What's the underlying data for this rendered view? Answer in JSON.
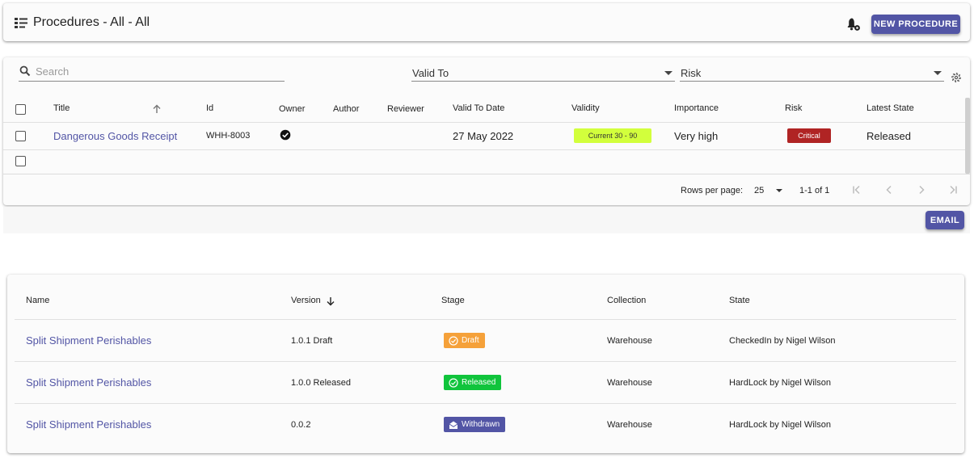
{
  "header": {
    "title": "Procedures - All - All",
    "new_button": "NEW PROCEDURE"
  },
  "filters": {
    "search_placeholder": "Search",
    "valid_to_label": "Valid To",
    "risk_label": "Risk"
  },
  "procedures_table": {
    "columns": [
      "Title",
      "Id",
      "Owner",
      "Author",
      "Reviewer",
      "Valid To Date",
      "Validity",
      "Importance",
      "Risk",
      "Latest State"
    ],
    "rows": [
      {
        "title": "Dangerous Goods Receipt",
        "id": "WHH-8003",
        "owner_checked": true,
        "author": "",
        "reviewer": "",
        "valid_to_date": "27 May 2022",
        "validity": "Current 30 - 90",
        "importance": "Very high",
        "risk": "Critical",
        "latest_state": "Released"
      }
    ],
    "pagination": {
      "rows_per_page_label": "Rows per page:",
      "rows_per_page": "25",
      "range": "1-1 of 1"
    }
  },
  "email_button": "EMAIL",
  "versions_table": {
    "columns": [
      "Name",
      "Version",
      "Stage",
      "Collection",
      "State"
    ],
    "rows": [
      {
        "name": "Split Shipment Perishables",
        "version": "1.0.1 Draft",
        "stage": "Draft",
        "collection": "Warehouse",
        "state": "CheckedIn by Nigel Wilson"
      },
      {
        "name": "Split Shipment Perishables",
        "version": "1.0.0 Released",
        "stage": "Released",
        "collection": "Warehouse",
        "state": "HardLock by Nigel Wilson"
      },
      {
        "name": "Split Shipment Perishables",
        "version": "0.0.2",
        "stage": "Withdrawn",
        "collection": "Warehouse",
        "state": "HardLock by Nigel Wilson"
      }
    ]
  },
  "colors": {
    "accent": "#5255a5",
    "validity_current": "#d2ff3c",
    "risk_critical": "#b02424",
    "stage_draft": "#f5a13a",
    "stage_released": "#10c43c",
    "stage_withdrawn": "#5255a5"
  },
  "icons": [
    "list-icon",
    "notification-settings-icon",
    "search-icon",
    "gear-icon",
    "arrow-up-icon",
    "check-circle-icon",
    "first-page-icon",
    "previous-page-icon",
    "next-page-icon",
    "last-page-icon",
    "arrow-down-icon",
    "clock-check-icon",
    "envelope-open-icon"
  ]
}
